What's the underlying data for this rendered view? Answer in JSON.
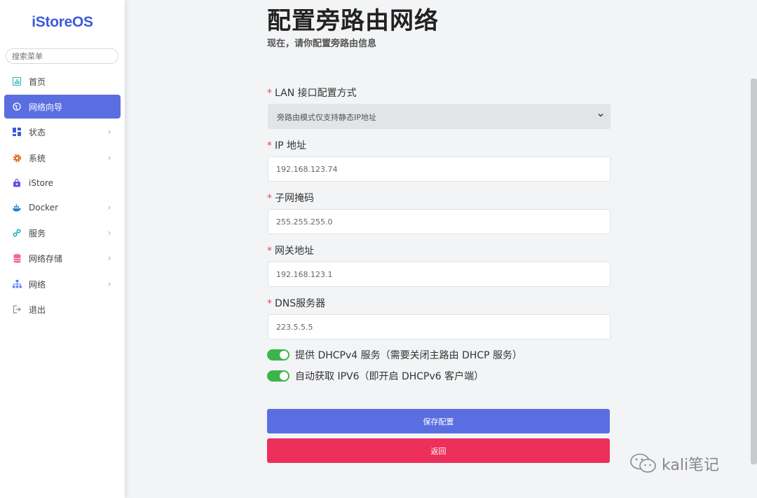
{
  "sidebar": {
    "logo": "iStoreOS",
    "search_placeholder": "搜索菜单",
    "items": [
      {
        "label": "首页",
        "icon": "dashboard-icon",
        "has_children": false,
        "active": false
      },
      {
        "label": "网络向导",
        "icon": "globe-icon",
        "has_children": false,
        "active": true
      },
      {
        "label": "状态",
        "icon": "grid-icon",
        "has_children": true,
        "active": false
      },
      {
        "label": "系统",
        "icon": "gear-icon",
        "has_children": true,
        "active": false
      },
      {
        "label": "iStore",
        "icon": "store-icon",
        "has_children": false,
        "active": false
      },
      {
        "label": "Docker",
        "icon": "docker-icon",
        "has_children": true,
        "active": false
      },
      {
        "label": "服务",
        "icon": "services-icon",
        "has_children": true,
        "active": false
      },
      {
        "label": "网络存储",
        "icon": "database-icon",
        "has_children": true,
        "active": false
      },
      {
        "label": "网络",
        "icon": "sitemap-icon",
        "has_children": true,
        "active": false
      },
      {
        "label": "退出",
        "icon": "logout-icon",
        "has_children": false,
        "active": false
      }
    ]
  },
  "main": {
    "title": "配置旁路由网络",
    "subtitle": "现在，请你配置旁路由信息",
    "required_mark": "*",
    "lan_mode": {
      "label": "LAN 接口配置方式",
      "value": "旁路由模式仅支持静态IP地址"
    },
    "ip": {
      "label": "IP 地址",
      "value": "192.168.123.74"
    },
    "netmask": {
      "label": "子网掩码",
      "value": "255.255.255.0"
    },
    "gateway": {
      "label": "网关地址",
      "value": "192.168.123.1"
    },
    "dns": {
      "label": "DNS服务器",
      "value": "223.5.5.5"
    },
    "dhcp_toggle": {
      "label": "提供 DHCPv4 服务（需要关闭主路由 DHCP 服务）",
      "on": true
    },
    "ipv6_toggle": {
      "label": "自动获取 IPV6（即开启 DHCPv6 客户端）",
      "on": true
    },
    "save_label": "保存配置",
    "back_label": "返回"
  },
  "watermark": {
    "text": "kali笔记"
  },
  "colors": {
    "accent": "#5b6ee1",
    "danger": "#ec2f5b",
    "toggle_on": "#3bb54a",
    "logo": "#3b5bdb"
  }
}
